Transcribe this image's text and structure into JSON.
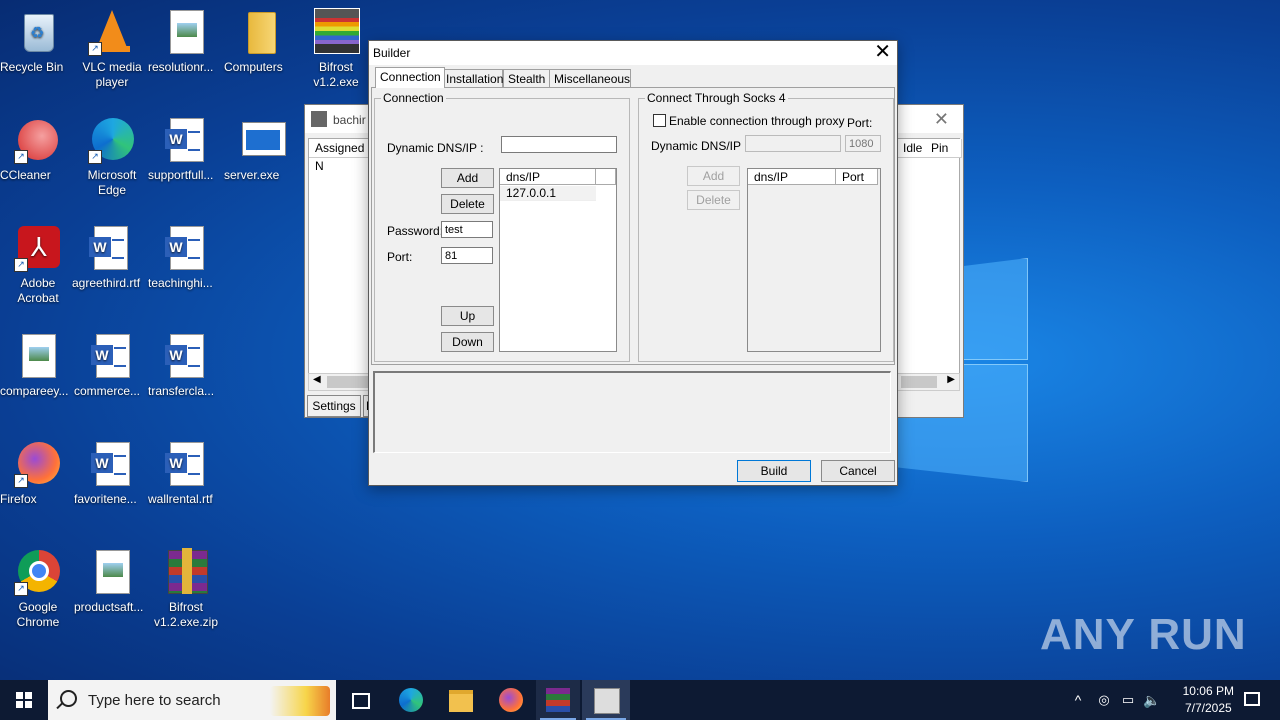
{
  "desktop": {
    "icons": [
      {
        "label": "Recycle Bin",
        "icon": "recycle-bin-icon"
      },
      {
        "label": "VLC media player",
        "icon": "vlc-icon"
      },
      {
        "label": "resolutionr...",
        "icon": "image-file-icon"
      },
      {
        "label": "Computers",
        "icon": "folder-icon"
      },
      {
        "label": "Bifrost v1.2.exe",
        "icon": "bifrost-exe-icon"
      },
      {
        "label": "CCleaner",
        "icon": "ccleaner-icon"
      },
      {
        "label": "Microsoft Edge",
        "icon": "edge-icon"
      },
      {
        "label": "supportfull...",
        "icon": "word-file-icon"
      },
      {
        "label": "server.exe",
        "icon": "exe-file-icon"
      },
      {
        "label": "Adobe Acrobat",
        "icon": "acrobat-icon"
      },
      {
        "label": "agreethird.rtf",
        "icon": "word-file-icon"
      },
      {
        "label": "teachinghi...",
        "icon": "word-file-icon"
      },
      {
        "label": "compareey...",
        "icon": "image-file-icon"
      },
      {
        "label": "commerce...",
        "icon": "word-file-icon"
      },
      {
        "label": "transfercla...",
        "icon": "word-file-icon"
      },
      {
        "label": "Firefox",
        "icon": "firefox-icon"
      },
      {
        "label": "favoritene...",
        "icon": "word-file-icon"
      },
      {
        "label": "wallrental.rtf",
        "icon": "word-file-icon"
      },
      {
        "label": "Google Chrome",
        "icon": "chrome-icon"
      },
      {
        "label": "productsaft...",
        "icon": "image-file-icon"
      },
      {
        "label": "Bifrost v1.2.exe.zip",
        "icon": "winrar-icon"
      }
    ]
  },
  "back_window": {
    "title": "bachir",
    "columns": [
      "Assigned N",
      "Idle",
      "Pin"
    ],
    "settings_label": "Settings",
    "second_tab": "E"
  },
  "builder": {
    "title": "Builder",
    "tabs": [
      "Connection",
      "Installation",
      "Stealth",
      "Miscellaneous"
    ],
    "connection": {
      "group_label": "Connection",
      "dns_label": "Dynamic DNS/IP :",
      "dns_value": "",
      "add_label": "Add",
      "delete_label": "Delete",
      "password_label": "Password:",
      "password_value": "test",
      "port_label": "Port:",
      "port_value": "81",
      "up_label": "Up",
      "down_label": "Down",
      "list_header": "dns/IP",
      "list_rows": [
        "127.0.0.1"
      ]
    },
    "socks": {
      "group_label": "Connect Through Socks 4",
      "enable_label": "Enable connection through proxy",
      "enable_checked": false,
      "port_label": "Port:",
      "dns_label": "Dynamic DNS/IP :",
      "dns_value": "",
      "port_value": "1080",
      "add_label": "Add",
      "delete_label": "Delete",
      "list_headers": [
        "dns/IP",
        "Port"
      ]
    },
    "build_label": "Build",
    "cancel_label": "Cancel"
  },
  "taskbar": {
    "search_placeholder": "Type here to search",
    "time": "10:06 PM",
    "date": "7/7/2025"
  },
  "watermark": "ANY RUN"
}
